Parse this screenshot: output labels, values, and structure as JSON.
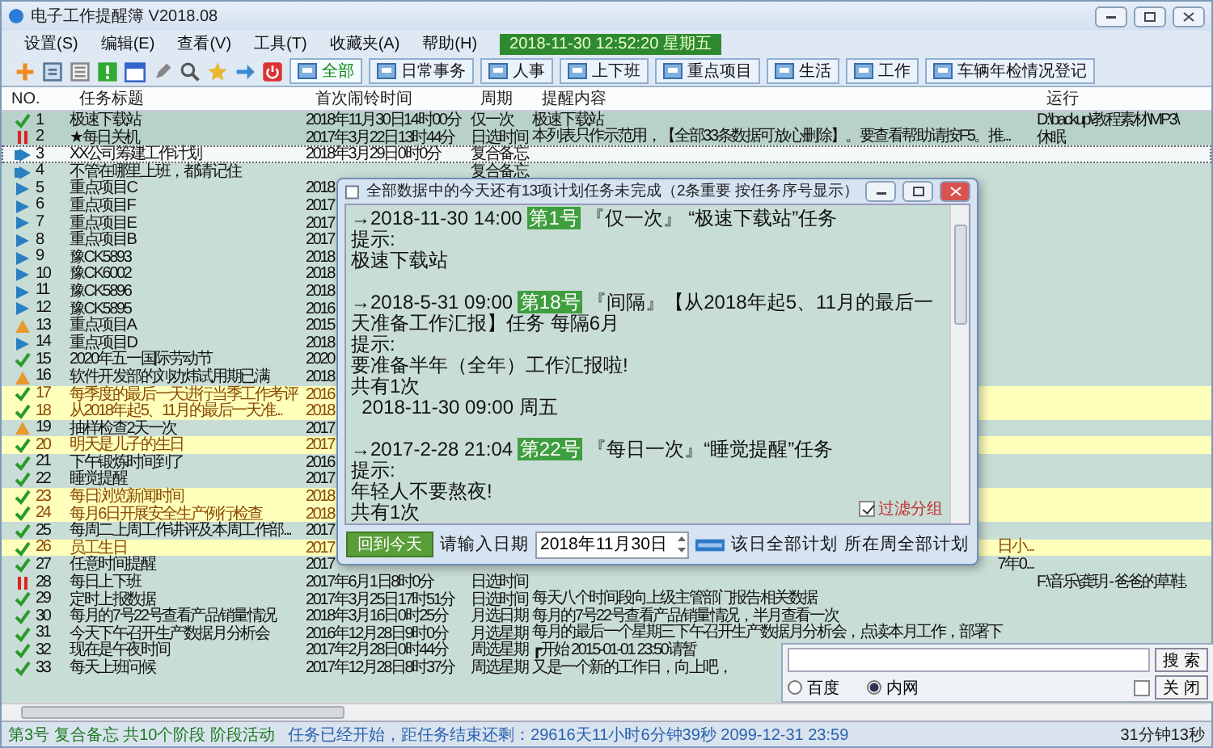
{
  "window": {
    "title": "电子工作提醒簿 V2018.08"
  },
  "menu": [
    "设置(S)",
    "编辑(E)",
    "查看(V)",
    "工具(T)",
    "收藏夹(A)",
    "帮助(H)"
  ],
  "clock": "2018-11-30 12:52:20 星期五",
  "toolbar": {
    "tabs": [
      {
        "label": "全部",
        "selected": true
      },
      {
        "label": "日常事务",
        "selected": false
      },
      {
        "label": "人事",
        "selected": false
      },
      {
        "label": "上下班",
        "selected": false
      },
      {
        "label": "重点项目",
        "selected": false
      },
      {
        "label": "生活",
        "selected": false
      },
      {
        "label": "工作",
        "selected": false
      },
      {
        "label": "车辆年检情况登记",
        "selected": false
      }
    ]
  },
  "table": {
    "columns": [
      "NO.",
      "任务标题",
      "首次闹铃时间",
      "周期",
      "提醒内容",
      "运行"
    ],
    "rows": [
      {
        "no": "1",
        "kind": "done",
        "selected": true,
        "current": false,
        "highlighted": false,
        "title": "极速下载站",
        "date": "2018年11月30日14时00分",
        "period": "仅一次",
        "content": "极速下载站",
        "run": "D:\\backup\\教程素材\\MP3\\"
      },
      {
        "no": "2",
        "kind": "paused",
        "selected": true,
        "current": false,
        "highlighted": false,
        "title": "★每日关机",
        "date": "2017年3月22日13时44分",
        "period": "日选时间",
        "content": "本列表只作示范用，【全部33条数据可放心删除】。要查看帮助请按F5。推...",
        "run": "休眠"
      },
      {
        "no": "3",
        "kind": "memo",
        "selected": false,
        "current": true,
        "highlighted": false,
        "title": "XX公司筹建工作计划",
        "date": "2018年3月29日0时0分",
        "period": "复合备忘"
      },
      {
        "no": "4",
        "kind": "memo",
        "selected": false,
        "current": false,
        "highlighted": false,
        "title": "不管在哪里上班，都请记住",
        "period": "复合备忘"
      },
      {
        "no": "5",
        "kind": "active",
        "selected": false,
        "current": false,
        "highlighted": false,
        "title": "重点项目C",
        "date": "2018"
      },
      {
        "no": "6",
        "kind": "active",
        "selected": false,
        "current": false,
        "highlighted": false,
        "title": "重点项目F",
        "date": "2017"
      },
      {
        "no": "7",
        "kind": "active",
        "selected": false,
        "current": false,
        "highlighted": false,
        "title": "重点项目E",
        "date": "2017"
      },
      {
        "no": "8",
        "kind": "active",
        "selected": false,
        "current": false,
        "highlighted": false,
        "title": "重点项目B",
        "date": "2017"
      },
      {
        "no": "9",
        "kind": "active",
        "selected": false,
        "current": false,
        "highlighted": false,
        "title": "豫CK5893",
        "date": "2018"
      },
      {
        "no": "10",
        "kind": "active",
        "selected": false,
        "current": false,
        "highlighted": false,
        "title": "豫CK6002",
        "date": "2018"
      },
      {
        "no": "11",
        "kind": "active",
        "selected": false,
        "current": false,
        "highlighted": false,
        "title": "豫CK5896",
        "date": "2018"
      },
      {
        "no": "12",
        "kind": "active",
        "selected": false,
        "current": false,
        "highlighted": false,
        "title": "豫CK5895",
        "date": "2016"
      },
      {
        "no": "13",
        "kind": "warning",
        "selected": false,
        "current": false,
        "highlighted": false,
        "title": "重点项目A",
        "date": "2015"
      },
      {
        "no": "14",
        "kind": "active",
        "selected": false,
        "current": false,
        "highlighted": false,
        "title": "重点项目D",
        "date": "2018"
      },
      {
        "no": "15",
        "kind": "done",
        "selected": false,
        "current": false,
        "highlighted": false,
        "title": "2020年五一国际劳动节",
        "date": "2020"
      },
      {
        "no": "16",
        "kind": "warning",
        "selected": false,
        "current": false,
        "highlighted": false,
        "title": "软件开发部的刘劝炜试用期已满",
        "date": "2018"
      },
      {
        "no": "17",
        "kind": "done",
        "selected": false,
        "current": false,
        "highlighted": true,
        "title": "每季度的最后一天进行当季工作考评",
        "date": "2016"
      },
      {
        "no": "18",
        "kind": "done",
        "selected": false,
        "current": false,
        "highlighted": true,
        "title": "从2018年起5、11月的最后一天准...",
        "date": "2018"
      },
      {
        "no": "19",
        "kind": "warning",
        "selected": false,
        "current": false,
        "highlighted": false,
        "title": "抽样检查2天一次",
        "date": "2017"
      },
      {
        "no": "20",
        "kind": "done",
        "selected": false,
        "current": false,
        "highlighted": true,
        "title": "明天是儿子的生日",
        "date": "2017"
      },
      {
        "no": "21",
        "kind": "done",
        "selected": false,
        "current": false,
        "highlighted": false,
        "title": "下午锻炼时间到了",
        "date": "2016"
      },
      {
        "no": "22",
        "kind": "done",
        "selected": false,
        "current": false,
        "highlighted": false,
        "title": "睡觉提醒",
        "date": "2017"
      },
      {
        "no": "23",
        "kind": "done",
        "selected": false,
        "current": false,
        "highlighted": true,
        "title": "每日浏览新闻时间",
        "date": "2018"
      },
      {
        "no": "24",
        "kind": "done",
        "selected": false,
        "current": false,
        "highlighted": true,
        "title": "每月6日开展安全生产例行检查",
        "date": "2018"
      },
      {
        "no": "25",
        "kind": "done",
        "selected": false,
        "current": false,
        "highlighted": false,
        "title": "每周二上周工作讲评及本周工作部...",
        "date": "2017"
      },
      {
        "no": "26",
        "kind": "done",
        "selected": false,
        "current": false,
        "highlighted": true,
        "title": "员工生日",
        "date": "2017",
        "content_tail": "日小..."
      },
      {
        "no": "27",
        "kind": "done",
        "selected": false,
        "current": false,
        "highlighted": false,
        "title": "任意时间提醒",
        "date": "2017",
        "content_tail": "7年0..."
      },
      {
        "no": "28",
        "kind": "paused",
        "selected": false,
        "current": false,
        "highlighted": false,
        "title": "每日上下班",
        "date": "2017年6月1日8时0分",
        "period": "日选时间",
        "run": "F:\\音乐\\龚玥 - 爸爸的草鞋."
      },
      {
        "no": "29",
        "kind": "done",
        "selected": false,
        "current": false,
        "highlighted": false,
        "title": "定时上报数据",
        "date": "2017年3月25日17时51分",
        "period": "日选时间",
        "content": "每天八个时间段向上级主管部门报告相关数据"
      },
      {
        "no": "30",
        "kind": "done",
        "selected": false,
        "current": false,
        "highlighted": false,
        "title": "每月的7号22号查看产品销量情况",
        "date": "2018年3月16日0时25分",
        "period": "月选日期",
        "content": "每月的7号22号查看产品销量情况，半月查看一次"
      },
      {
        "no": "31",
        "kind": "done",
        "selected": false,
        "current": false,
        "highlighted": false,
        "title": "今天下午召开生产数据月分析会",
        "date": "2016年12月28日9时0分",
        "period": "月选星期",
        "content": "每月的最后一个星期三下午召开生产数据月分析会，点读本月工作，部署下"
      },
      {
        "no": "32",
        "kind": "done",
        "selected": false,
        "current": false,
        "highlighted": false,
        "title": "现在是午夜时间",
        "date": "2017年2月28日0时44分",
        "period": "周选星期",
        "content": "┏开始 2015-01-01 23:50请暂"
      },
      {
        "no": "33",
        "kind": "done",
        "selected": false,
        "current": false,
        "highlighted": false,
        "title": "每天上班问候",
        "date": "2017年12月28日8时37分",
        "period": "周选星期",
        "content": "又是一个新的工作日，向上吧，"
      }
    ]
  },
  "dialog": {
    "title": "全部数据中的今天还有13项计划任务未完成（2条重要 按任务序号显示）",
    "entries": [
      {
        "time": "→2018-11-30 14:00",
        "number": "第1号",
        "text": "『仅一次』 “极速下载站”任务",
        "lines": [
          "提示:",
          "极速下载站"
        ]
      },
      {
        "time": "→2018-5-31 09:00",
        "number": "第18号",
        "text": "『间隔』【从2018年起5、11月的最后一天准备工作汇报】任务 每隔6月",
        "lines": [
          "提示:",
          "要准备半年（全年）工作汇报啦!",
          "共有1次",
          "  2018-11-30 09:00 周五"
        ]
      },
      {
        "time": "→2017-2-28 21:04",
        "number": "第22号",
        "text": "『每日一次』“睡觉提醒”任务",
        "lines": [
          "提示:",
          "年轻人不要熬夜!",
          "共有1次"
        ]
      }
    ],
    "filter": {
      "label": "过滤分组",
      "checked": true
    },
    "today_button": "回到今天",
    "date_label": "请输入日期",
    "date_value": "2018年11月30日",
    "day_plans": "该日全部计划",
    "week_plans": "所在周全部计划"
  },
  "search_popup": {
    "engines": [
      {
        "label": "百度",
        "selected": false
      },
      {
        "label": "内网",
        "selected": true
      }
    ],
    "search_button": "搜 索",
    "close_button": "关 闭",
    "pin_checked": false
  },
  "status_bar": {
    "task": "第3号 复合备忘 共10个阶段 阶段活动",
    "remaining": "任务已经开始，距任务结束还剩：29616天11小时6分钟39秒 2099-12-31 23:59",
    "elapsed": "31分钟13秒"
  }
}
